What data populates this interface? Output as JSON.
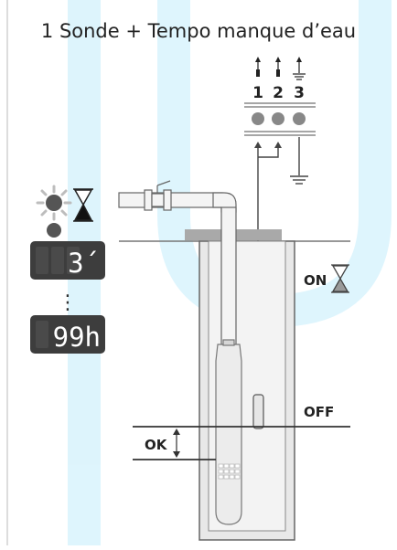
{
  "title": "1 Sonde + Tempo manque d’eau",
  "terminals": [
    "1",
    "2",
    "3"
  ],
  "displays": [
    "3´",
    "99h"
  ],
  "ellipsis": "⋮",
  "labels": {
    "on": "ON",
    "off": "OFF",
    "ok": "OK"
  },
  "colors": {
    "accent": "#00aeef",
    "display_bg": "#3d3d3d",
    "display_text": "#ffffff",
    "pipe": "#f4f4f4"
  },
  "icons": [
    "hourglass-icon",
    "blinking-led-icon",
    "ground-icon",
    "probe-icon",
    "pump-icon",
    "valve-icon"
  ]
}
